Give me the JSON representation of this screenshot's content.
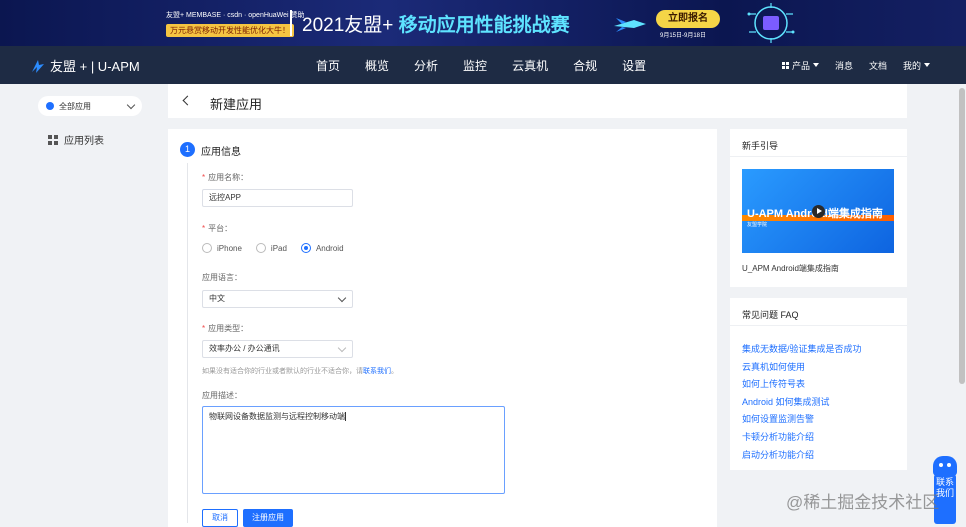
{
  "banner": {
    "logos_text": "友盟+  MEMBASE · csdn · openHuaWei 赞助",
    "tag": "万元悬赏移动开发性能优化大牛！",
    "title_prefix": "2021友盟+",
    "title_highlight": "移动应用性能挑战赛",
    "cta": "立即报名",
    "date_range": "9月15日-9月18日"
  },
  "topnav": {
    "brand": "友盟 + | U-APM",
    "items": [
      "首页",
      "概览",
      "分析",
      "监控",
      "云真机",
      "合规",
      "设置"
    ],
    "right": {
      "products": "产品",
      "messages": "消息",
      "docs": "文档",
      "mine": "我的"
    }
  },
  "sidebar": {
    "app_select": "全部应用",
    "app_list": "应用列表"
  },
  "header": {
    "title": "新建应用"
  },
  "form": {
    "step_number": "1",
    "step_title": "应用信息",
    "name_label": "应用名称：",
    "name_value": "远控APP",
    "platform_label": "平台：",
    "platforms": [
      {
        "label": "iPhone",
        "selected": false
      },
      {
        "label": "iPad",
        "selected": false
      },
      {
        "label": "Android",
        "selected": true
      }
    ],
    "language_label": "应用语言：",
    "language_value": "中文",
    "type_label": "应用类型：",
    "type_value": "效率办公 / 办公通讯",
    "hint_text": "如果没有适合你的行业或者默认的行业不适合你，请",
    "hint_link": "联系我们",
    "hint_end": "。",
    "desc_label": "应用描述：",
    "desc_value": "物联网设备数据监测与远程控制移动端",
    "cancel": "取消",
    "submit": "注册应用"
  },
  "guide": {
    "title": "新手引导",
    "video_title": "U-APM Android端集成指南",
    "video_sub": "友盟学院",
    "caption": "U_APM Android端集成指南"
  },
  "faq": {
    "title": "常见问题 FAQ",
    "items": [
      "集成无数据/验证集成是否成功",
      "云真机如何使用",
      "如何上传符号表",
      "Android 如何集成测试",
      "如何设置监测告警",
      "卡顿分析功能介绍",
      "启动分析功能介绍"
    ]
  },
  "contact": {
    "label": "联系我们"
  },
  "watermark": "@稀土掘金技术社区",
  "colors": {
    "accent": "#1e6fff",
    "nav_bg": "#1e2b44",
    "banner_bg": "#0b1650",
    "required": "#f04a4a"
  }
}
